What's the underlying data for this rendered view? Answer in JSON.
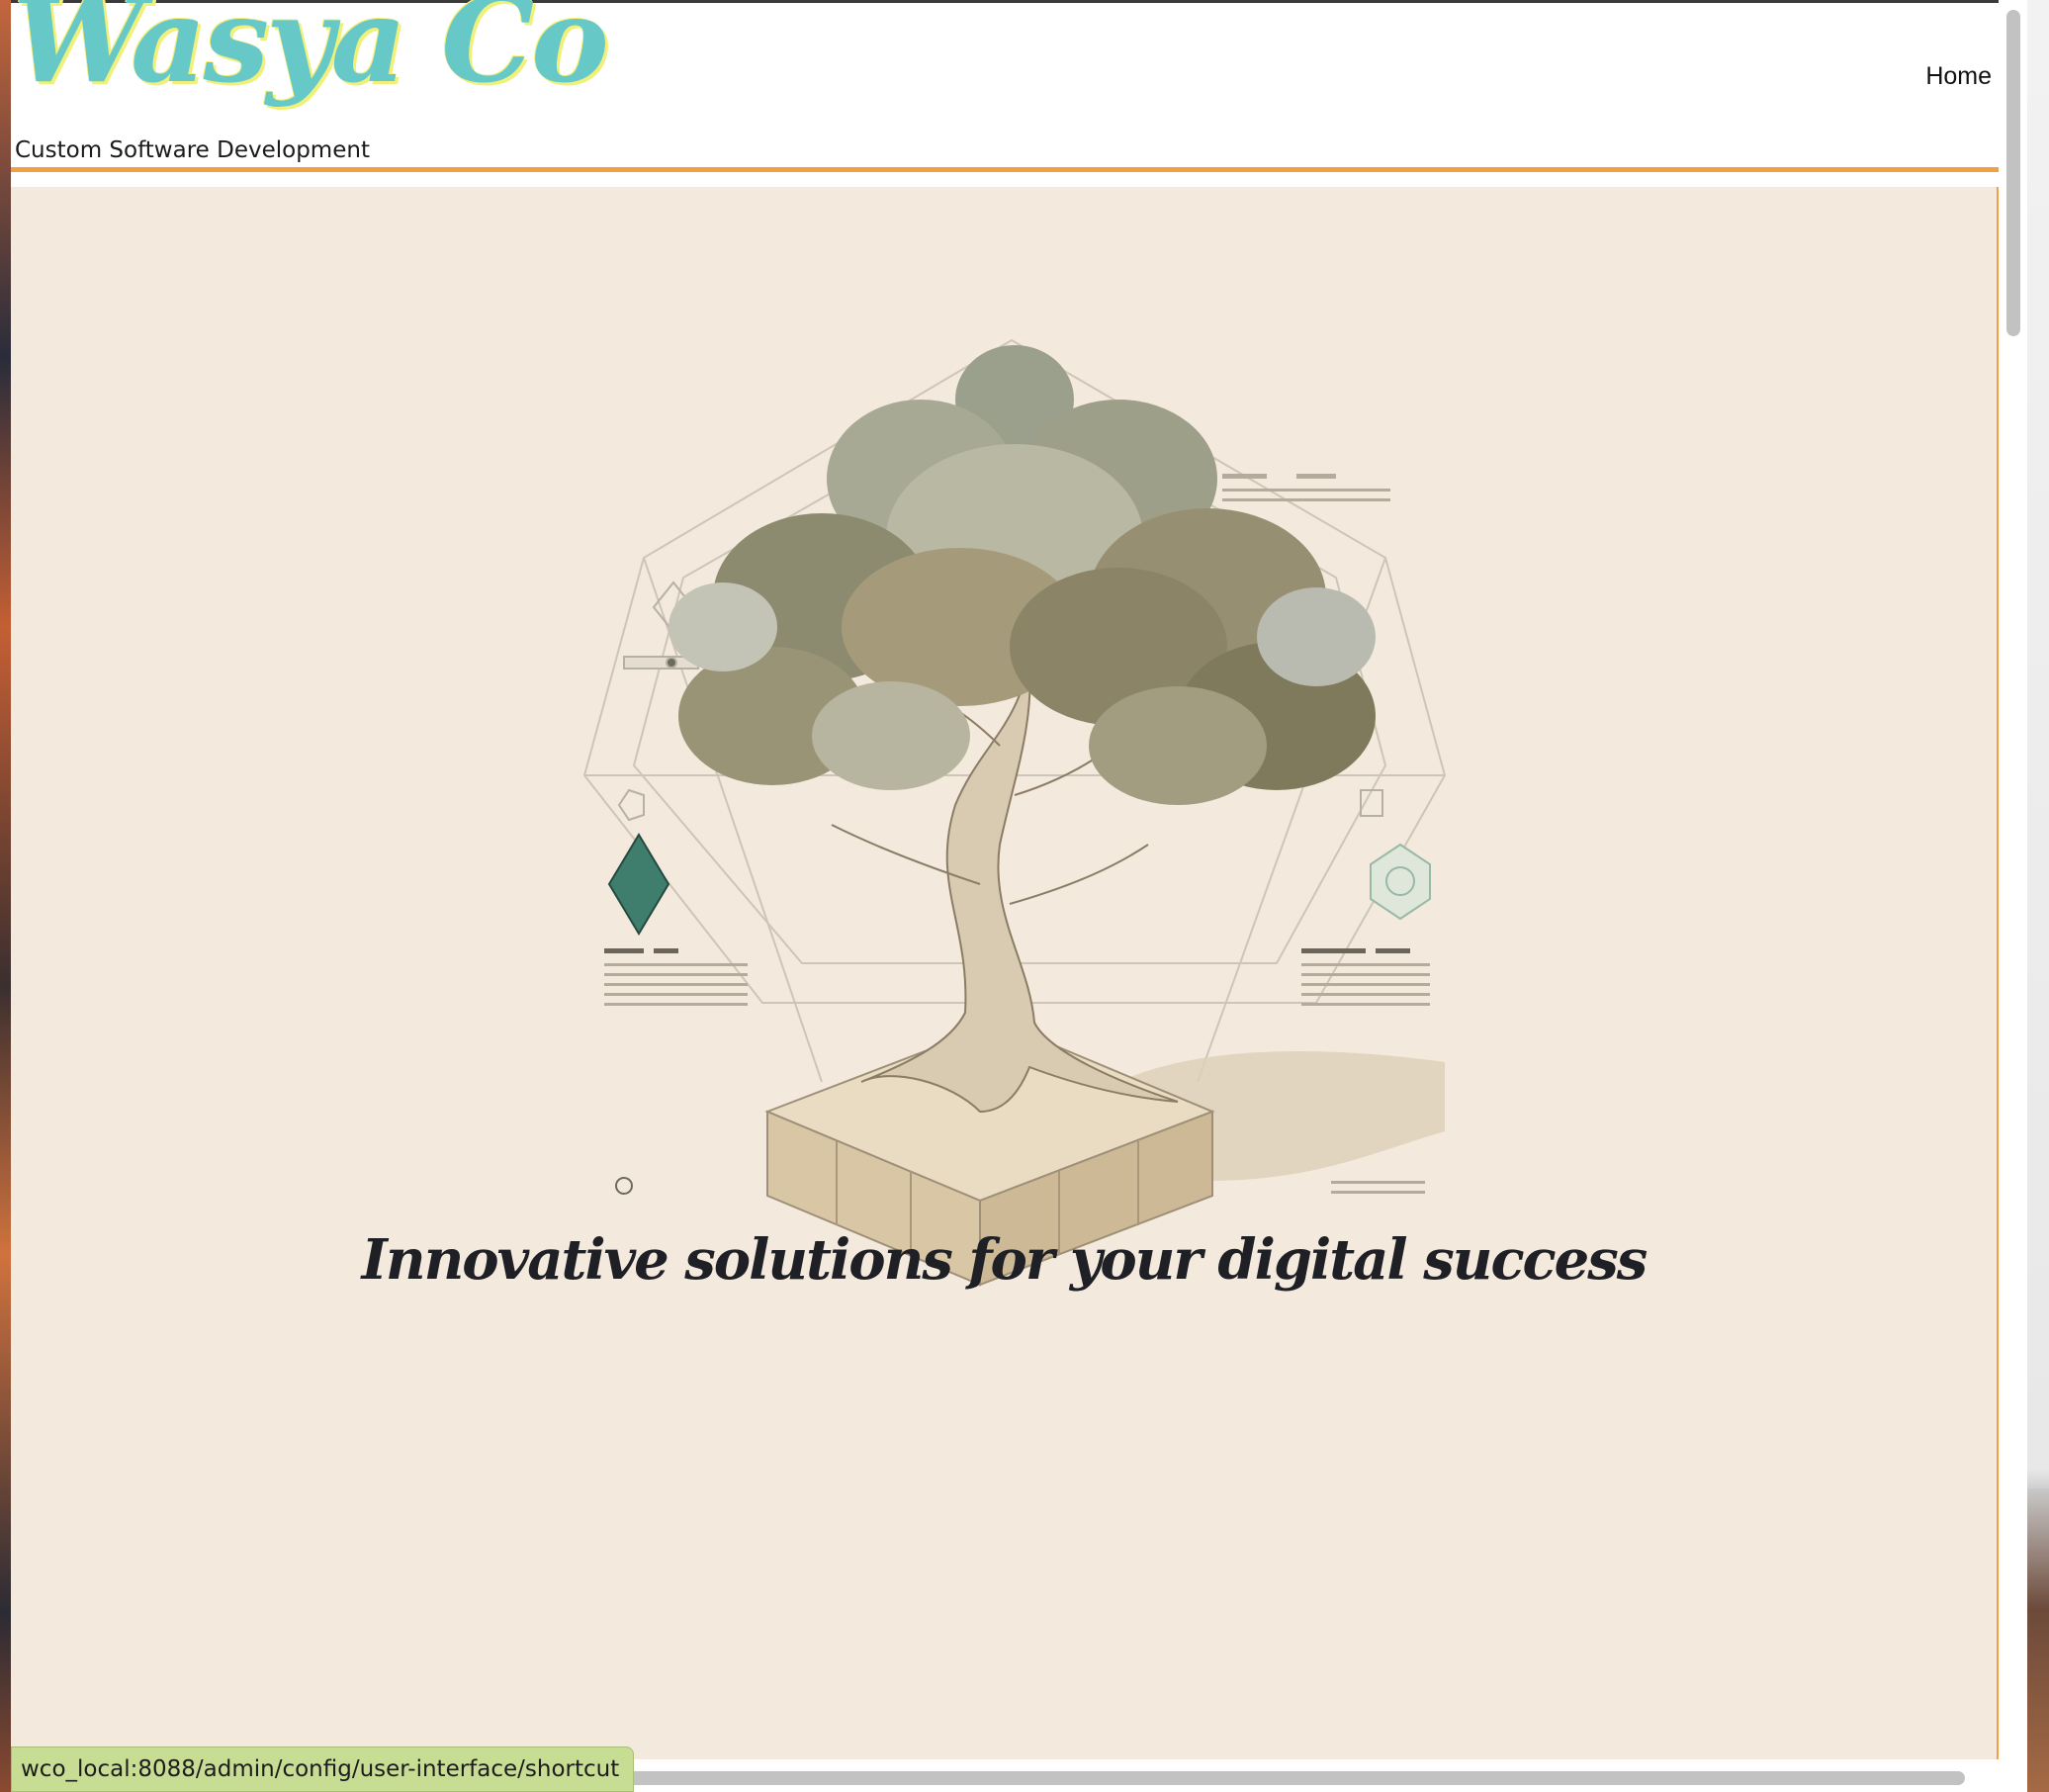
{
  "site": {
    "logo_text": "Wasya Co",
    "tagline": "Custom Software Development"
  },
  "nav": {
    "items": [
      {
        "label": "Home"
      }
    ]
  },
  "hero": {
    "image_icon": "tree-on-wooden-block-illustration",
    "headline": "Innovative solutions for your digital success"
  },
  "status_bar": {
    "url": "wco_local:8088/admin/config/user-interface/shortcut"
  },
  "colors": {
    "logo": "#67c8c8",
    "logo_outline": "#f1f07a",
    "accent_rule": "#f0a043",
    "hero_background": "#f3e9dc",
    "headline": "#1f1f26",
    "status_bar": "#c8dd94"
  }
}
